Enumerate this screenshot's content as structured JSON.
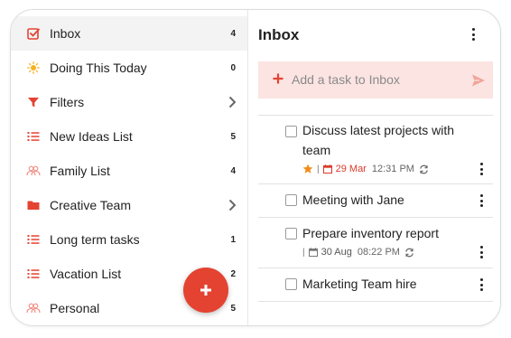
{
  "colors": {
    "accent": "#e44332",
    "add_bar_bg": "#fbe4e2",
    "active_bg": "#f3f3f3"
  },
  "sidebar": {
    "items": [
      {
        "label": "Inbox",
        "count": "4",
        "icon": "inbox-check-icon",
        "active": true
      },
      {
        "label": "Doing This Today",
        "count": "0",
        "icon": "sun-icon"
      },
      {
        "label": "Filters",
        "count": "",
        "icon": "filter-icon",
        "chevron": true
      },
      {
        "label": "New Ideas List",
        "count": "5",
        "icon": "list-icon"
      },
      {
        "label": "Family List",
        "count": "4",
        "icon": "shared-people-icon"
      },
      {
        "label": "Creative Team",
        "count": "",
        "icon": "folder-icon",
        "chevron": true
      },
      {
        "label": "Long term tasks",
        "count": "1",
        "icon": "list-icon"
      },
      {
        "label": "Vacation List",
        "count": "2",
        "icon": "list-icon"
      },
      {
        "label": "Personal",
        "count": "5",
        "icon": "shared-people-icon"
      }
    ],
    "fab_icon": "plus-icon"
  },
  "main": {
    "title": "Inbox",
    "add_task": {
      "placeholder": "Add a task to Inbox"
    },
    "tasks": [
      {
        "title": "Discuss latest projects with team",
        "starred": true,
        "due": "29 Mar",
        "due_overdue": true,
        "time": "12:31 PM",
        "repeat": true
      },
      {
        "title": "Meeting with Jane"
      },
      {
        "title": "Prepare inventory report",
        "starred": false,
        "due": "30 Aug",
        "due_overdue": false,
        "time": "08:22 PM",
        "repeat": true
      },
      {
        "title": "Marketing Team hire"
      }
    ]
  }
}
